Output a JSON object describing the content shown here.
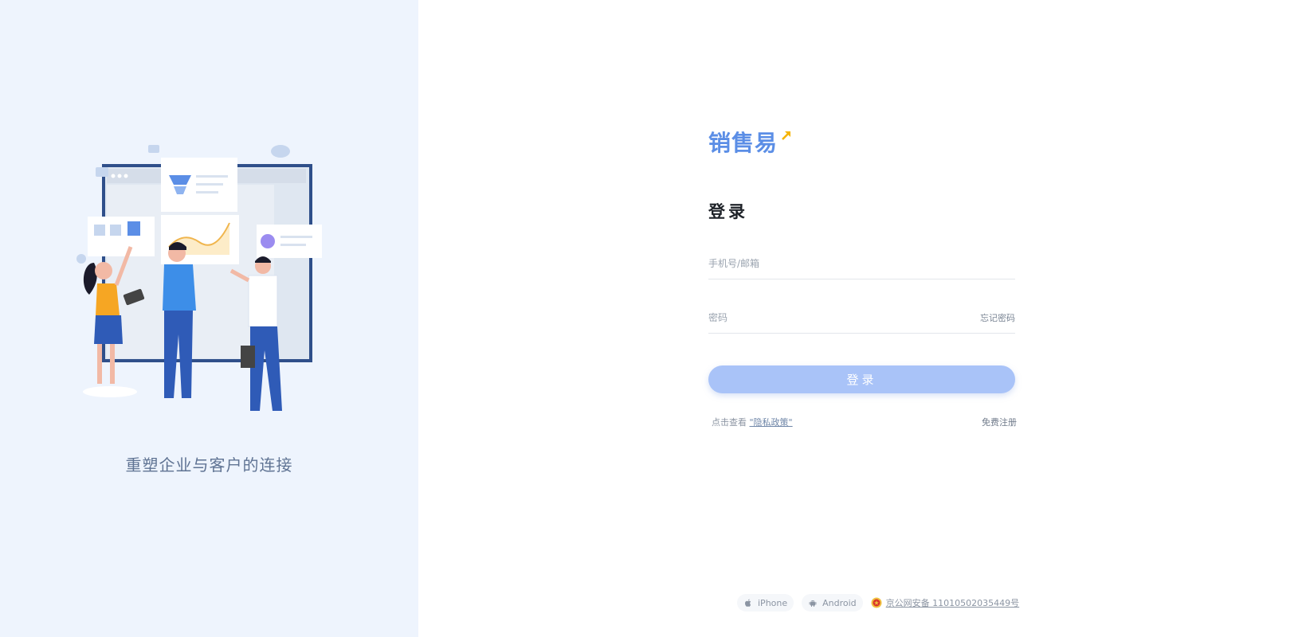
{
  "brand": {
    "logo_text": "销售易"
  },
  "left": {
    "slogan": "重塑企业与客户的连接"
  },
  "login": {
    "title": "登录",
    "account_placeholder": "手机号/邮箱",
    "password_placeholder": "密码",
    "forgot_label": "忘记密码",
    "submit_label": "登录",
    "privacy_prefix": "点击查看",
    "privacy_link": "\"隐私政策\"",
    "register_label": "免费注册"
  },
  "footer": {
    "iphone_label": "iPhone",
    "android_label": "Android",
    "beian_text": "京公网安备 11010502035449号"
  },
  "colors": {
    "accent": "#5b8ee6",
    "button": "#a9c3f8",
    "left_bg": "#eef4fd"
  },
  "icons": [
    "illustration-team",
    "logo-arrow-icon",
    "apple-icon",
    "android-icon",
    "police-badge-icon"
  ]
}
